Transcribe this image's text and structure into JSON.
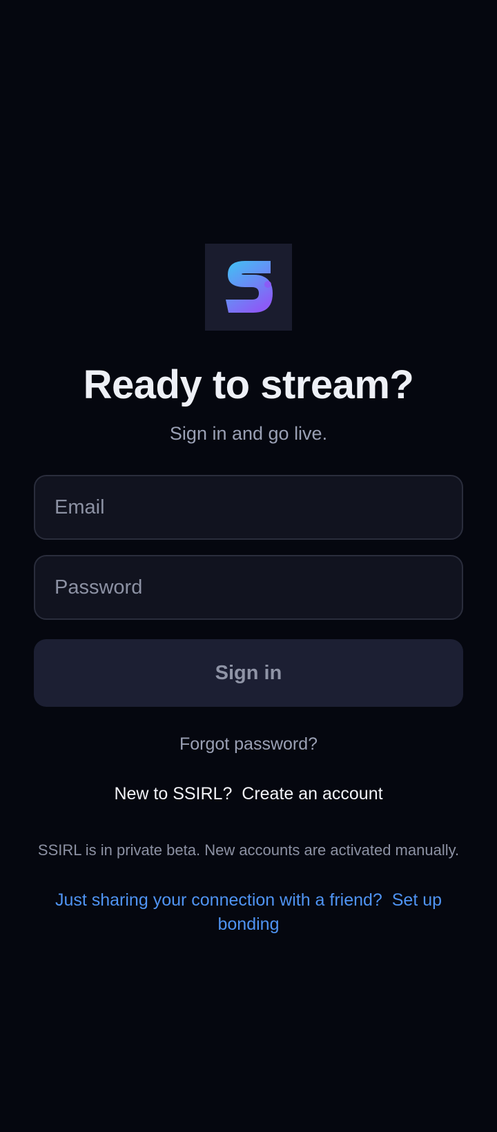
{
  "brand": {
    "logo_icon": "ssirl-s-logo-icon",
    "logo_bg": "#1a1c2e",
    "gradient_start": "#3fc4f4",
    "gradient_end": "#8b5cf6"
  },
  "header": {
    "title": "Ready to stream?",
    "subtitle": "Sign in and go live."
  },
  "form": {
    "email_placeholder": "Email",
    "email_value": "",
    "password_placeholder": "Password",
    "password_value": "",
    "signin_label": "Sign in"
  },
  "links": {
    "forgot_password": "Forgot password?",
    "new_prompt": "New to SSIRL?",
    "create_account": "Create an account",
    "bonding_prompt": "Just sharing your connection with a friend?",
    "bonding_link": "Set up bonding"
  },
  "notes": {
    "beta": "SSIRL is in private beta. New accounts are activated manually."
  },
  "colors": {
    "background": "#05070f",
    "field_bg": "#11131f",
    "button_bg": "#1c1f33",
    "link_blue": "#4f93f2",
    "muted_text": "#9aa0b4"
  }
}
